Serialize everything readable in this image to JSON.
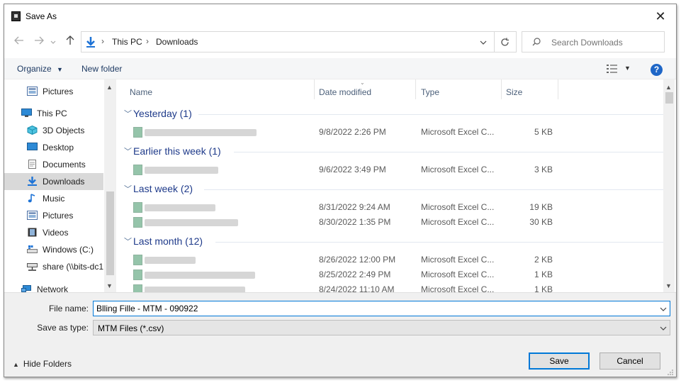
{
  "window": {
    "title": "Save As",
    "close_glyph": "✕"
  },
  "address": {
    "crumbs": [
      "This PC",
      "Downloads"
    ],
    "search_placeholder": "Search Downloads"
  },
  "toolbar": {
    "organize_label": "Organize",
    "new_folder_label": "New folder",
    "help_glyph": "?"
  },
  "nav": {
    "items": [
      {
        "label": "Pictures",
        "icon": "pictures-icon"
      },
      {
        "label": "This PC",
        "icon": "this-pc-icon"
      },
      {
        "label": "3D Objects",
        "icon": "3d-objects-icon"
      },
      {
        "label": "Desktop",
        "icon": "desktop-icon"
      },
      {
        "label": "Documents",
        "icon": "documents-icon"
      },
      {
        "label": "Downloads",
        "icon": "downloads-icon",
        "selected": true
      },
      {
        "label": "Music",
        "icon": "music-icon"
      },
      {
        "label": "Pictures",
        "icon": "pictures-icon"
      },
      {
        "label": "Videos",
        "icon": "videos-icon"
      },
      {
        "label": "Windows (C:)",
        "icon": "drive-icon"
      },
      {
        "label": "share (\\\\bits-dc1",
        "icon": "network-drive-icon"
      },
      {
        "label": "Network",
        "icon": "network-icon"
      }
    ]
  },
  "columns": {
    "name": "Name",
    "date_modified": "Date modified",
    "type": "Type",
    "size": "Size"
  },
  "groups": [
    {
      "label": "Yesterday (1)",
      "files": [
        {
          "date": "9/8/2022 2:26 PM",
          "type": "Microsoft Excel C...",
          "size": "5 KB"
        }
      ]
    },
    {
      "label": "Earlier this week (1)",
      "files": [
        {
          "date": "9/6/2022 3:49 PM",
          "type": "Microsoft Excel C...",
          "size": "3 KB"
        }
      ]
    },
    {
      "label": "Last week (2)",
      "files": [
        {
          "date": "8/31/2022 9:24 AM",
          "type": "Microsoft Excel C...",
          "size": "19 KB"
        },
        {
          "date": "8/30/2022 1:35 PM",
          "type": "Microsoft Excel C...",
          "size": "30 KB"
        }
      ]
    },
    {
      "label": "Last month (12)",
      "files": [
        {
          "date": "8/26/2022 12:00 PM",
          "type": "Microsoft Excel C...",
          "size": "2 KB"
        },
        {
          "date": "8/25/2022 2:49 PM",
          "type": "Microsoft Excel C...",
          "size": "1 KB"
        },
        {
          "date": "8/24/2022 11:10 AM",
          "type": "Microsoft Excel C...",
          "size": "1 KB"
        }
      ]
    }
  ],
  "form": {
    "file_name_label": "File name:",
    "file_name_value": "Blling Fille - MTM - 090922",
    "save_as_type_label": "Save as type:",
    "save_as_type_value": "MTM Files (*.csv)"
  },
  "footer": {
    "hide_folders_label": "Hide Folders",
    "save_label": "Save",
    "cancel_label": "Cancel"
  },
  "colors": {
    "accent": "#0078d7",
    "group_text": "#1e3a8a",
    "selected_bg": "#d9d9d9"
  }
}
